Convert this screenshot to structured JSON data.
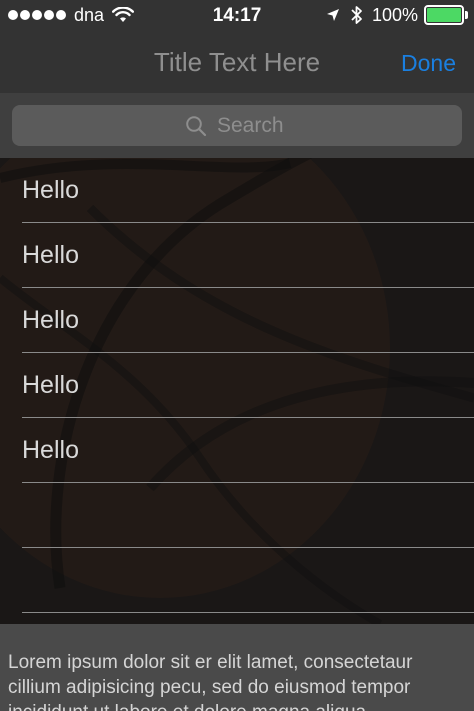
{
  "status_bar": {
    "carrier": "dna",
    "time": "14:17",
    "battery_percent": "100%",
    "battery_level": 1.0,
    "signal_bars": 5,
    "battery_color": "#4cd964"
  },
  "nav": {
    "title": "Title Text Here",
    "done_label": "Done",
    "done_color": "#1a7fe0"
  },
  "search": {
    "placeholder": "Search"
  },
  "list": {
    "items": [
      {
        "label": "Hello"
      },
      {
        "label": "Hello"
      },
      {
        "label": "Hello"
      },
      {
        "label": "Hello"
      },
      {
        "label": "Hello"
      },
      {
        "label": ""
      },
      {
        "label": ""
      }
    ]
  },
  "footer": {
    "text": "Lorem ipsum dolor sit er elit lamet, consectetaur cillium adipisicing pecu, sed do eiusmod tempor incididunt ut labore et dolore magna aliqua."
  }
}
